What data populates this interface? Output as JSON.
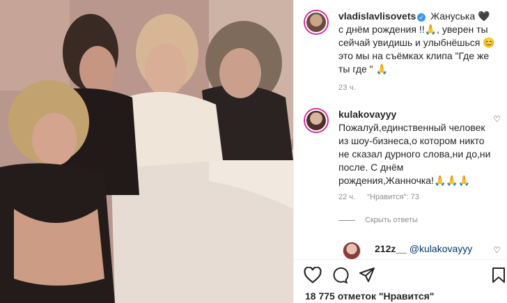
{
  "post": {
    "username": "vladislavlisovets",
    "caption": "Жануська 🖤 с днём рождения !!🙏, уверен ты сейчай увидишь и улыбнёшься 😊 это мы на съёмках клипа \"Где же ты где \" 🙏",
    "time": "23 ч."
  },
  "comment": {
    "username": "kulakovayyy",
    "text": "Пожалуй,единственный человек из шоу-бизнеса,о котором никто не сказал дурного слова,ни до,ни после. С днём рождения,Жанночка!🙏🙏🙏",
    "time": "22 ч.",
    "likes": "\"Нравится\": 73",
    "hide_replies": "Скрыть ответы"
  },
  "reply": {
    "username": "212z__",
    "mention": "@kulakovayyy"
  },
  "footer": {
    "likes_count": "18 775 отметок \"Нравится\""
  },
  "icons": {
    "verified": "verified-badge-icon",
    "heart": "heart-icon",
    "comment": "comment-icon",
    "share": "share-icon",
    "save": "bookmark-icon"
  },
  "colors": {
    "verified": "#3897f0",
    "mention": "#00376b",
    "muted": "#8e8e8e"
  }
}
